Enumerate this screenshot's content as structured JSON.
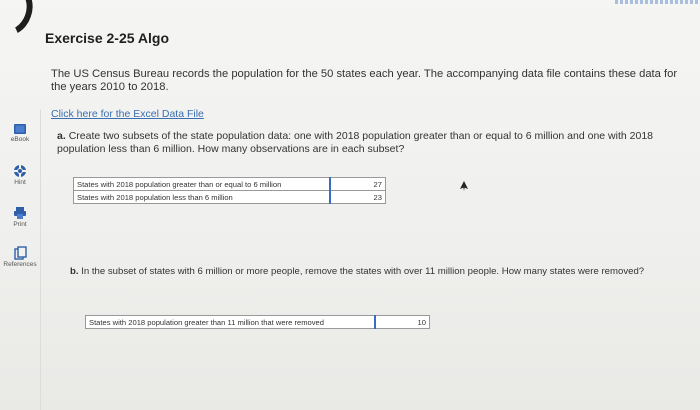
{
  "exercise": {
    "title": "Exercise 2-25 Algo",
    "intro": "The US Census Bureau records the population for the 50 states each year. The accompanying data file contains these data for the years 2010 to 2018.",
    "link_label": "Click here for the Excel Data File"
  },
  "sidebar": {
    "items": [
      {
        "label": "eBook",
        "icon": "book-icon"
      },
      {
        "label": "Hint",
        "icon": "lifebuoy-icon"
      },
      {
        "label": "Print",
        "icon": "printer-icon"
      },
      {
        "label": "References",
        "icon": "references-icon"
      }
    ]
  },
  "part_a": {
    "marker": "a.",
    "question": "Create two subsets of the state population data: one with 2018 population greater than or equal to 6 million and one with 2018 population less than 6 million. How many observations are in each subset?",
    "rows": [
      {
        "label": "States with 2018 population greater than or equal to 6 million",
        "value": "27"
      },
      {
        "label": "States with 2018 population less than 6 million",
        "value": "23"
      }
    ]
  },
  "part_b": {
    "marker": "b.",
    "question": "In the subset of states with 6 million or more people, remove the states with over 11 million people. How many states were removed?",
    "rows": [
      {
        "label": "States with 2018 population greater than 11 million that were removed",
        "value": "10"
      }
    ]
  }
}
